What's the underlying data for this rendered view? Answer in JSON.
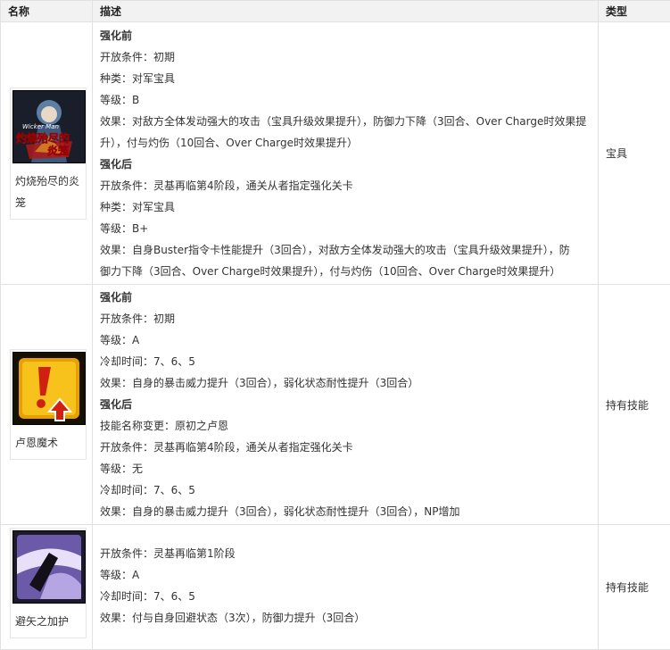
{
  "headers": {
    "name": "名称",
    "desc": "描述",
    "type": "类型"
  },
  "rows": [
    {
      "name": "灼烧殆尽的炎笼",
      "img_icon": "wicker-man-icon",
      "img_text_a": "Wicker Man",
      "img_text_b": "灼烧殆尽的",
      "img_text_c": "炎笼",
      "type": "宝具",
      "lines": [
        {
          "text": "强化前",
          "bold": true
        },
        {
          "text": "开放条件：初期"
        },
        {
          "text": "种类：对军宝具"
        },
        {
          "text": "等级：B"
        },
        {
          "text": "效果：对敌方全体发动强大的攻击（宝具升级效果提升），防御力下降（3回合、Over Charge时效果提"
        },
        {
          "text": "升），付与灼伤（10回合、Over Charge时效果提升）"
        },
        {
          "text": "强化后",
          "bold": true
        },
        {
          "text": "开放条件：灵基再临第4阶段，通关从者指定强化关卡"
        },
        {
          "text": "种类：对军宝具"
        },
        {
          "text": "等级：B+"
        },
        {
          "text": "效果：自身Buster指令卡性能提升（3回合），对敌方全体发动强大的攻击（宝具升级效果提升），防"
        },
        {
          "text": "御力下降（3回合、Over Charge时效果提升），付与灼伤（10回合、Over Charge时效果提升）"
        }
      ]
    },
    {
      "name": "卢恩魔术",
      "img_icon": "crit-up-icon",
      "type": "持有技能",
      "lines": [
        {
          "text": "强化前",
          "bold": true
        },
        {
          "text": "开放条件：初期"
        },
        {
          "text": "等级：A"
        },
        {
          "text": "冷却时间：7、6、5"
        },
        {
          "text": "效果：自身的暴击威力提升（3回合），弱化状态耐性提升（3回合）"
        },
        {
          "text": "强化后",
          "bold": true
        },
        {
          "text": "技能名称变更：原初之卢恩"
        },
        {
          "text": "开放条件：灵基再临第4阶段，通关从者指定强化关卡"
        },
        {
          "text": "等级：无"
        },
        {
          "text": "冷却时间：7、6、5"
        },
        {
          "text": "效果：自身的暴击威力提升（3回合），弱化状态耐性提升（3回合），NP增加"
        }
      ]
    },
    {
      "name": "避矢之加护",
      "img_icon": "evasion-icon",
      "type": "持有技能",
      "lines": [
        {
          "text": "开放条件：灵基再临第1阶段"
        },
        {
          "text": "等级：A"
        },
        {
          "text": "冷却时间：7、6、5"
        },
        {
          "text": "效果：付与自身回避状态（3次），防御力提升（3回合）"
        }
      ]
    }
  ]
}
